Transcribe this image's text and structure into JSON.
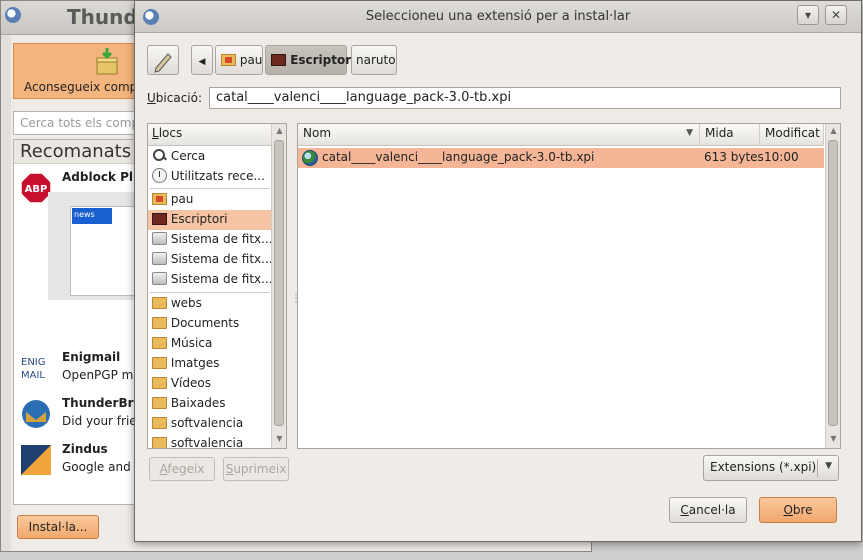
{
  "background_window": {
    "title": "Thunde",
    "get_addons_label": "Aconsegueix comple",
    "search_placeholder": "Cerca tots els compl",
    "recommended_heading": "Recomanats",
    "addons": [
      {
        "name": "Adblock Plus",
        "description": ""
      },
      {
        "name": "Enigmail",
        "description": "OpenPGP me"
      },
      {
        "name": "ThunderBrow",
        "description": "Did your frien"
      },
      {
        "name": "Zindus",
        "description": "Google and Z"
      }
    ],
    "abp_icon_text": "ABP",
    "enigmail_icon_text": "ENIG MAIL",
    "install_button": "Instal·la..."
  },
  "dialog": {
    "title": "Seleccioneu una extensió per a instal·lar",
    "path_buttons": [
      "pau",
      "Escriptori",
      "naruto"
    ],
    "location_label": "Ubicació:",
    "location_value": "catal____valenci____language_pack-3.0-tb.xpi",
    "places_header": "Llocs",
    "places": [
      {
        "label": "Cerca",
        "icon": "search-icon"
      },
      {
        "label": "Utilitzats rece...",
        "icon": "clock-icon"
      },
      {
        "label": "pau",
        "icon": "home-folder-icon"
      },
      {
        "label": "Escriptori",
        "icon": "desktop-icon"
      },
      {
        "label": "Sistema de fitx...",
        "icon": "drive-icon"
      },
      {
        "label": "Sistema de fitx...",
        "icon": "drive-icon"
      },
      {
        "label": "Sistema de fitx...",
        "icon": "drive-icon"
      },
      {
        "label": "webs",
        "icon": "folder-icon"
      },
      {
        "label": "Documents",
        "icon": "documents-icon"
      },
      {
        "label": "Música",
        "icon": "music-icon"
      },
      {
        "label": "Imatges",
        "icon": "pictures-icon"
      },
      {
        "label": "Vídeos",
        "icon": "videos-icon"
      },
      {
        "label": "Baixades",
        "icon": "downloads-icon"
      },
      {
        "label": "softvalencia",
        "icon": "folder-icon"
      },
      {
        "label": "softvalencia",
        "icon": "folder-icon"
      }
    ],
    "add_button": "Afegeix",
    "remove_button": "Suprimeix",
    "columns": {
      "name": "Nom",
      "size": "Mida",
      "modified": "Modificat"
    },
    "files": [
      {
        "name": "catal____valenci____language_pack-3.0-tb.xpi",
        "size": "613 bytes",
        "modified": "10:00"
      }
    ],
    "filter": "Extensions (*.xpi)",
    "cancel_button": "Cancel·la",
    "open_button": "Obre"
  },
  "colors": {
    "selection": "#f4b697",
    "accent_button": "#f0a96d",
    "window_bg": "#efebe7"
  }
}
